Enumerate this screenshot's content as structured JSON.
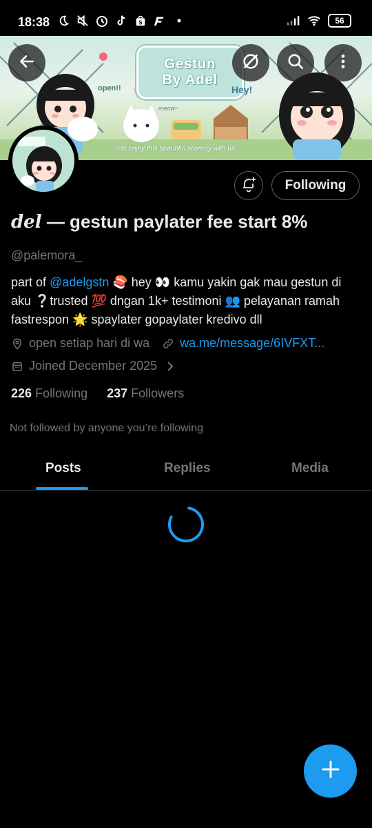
{
  "status_bar": {
    "time": "18:38",
    "battery": "56",
    "icons": [
      "moon-icon",
      "mute-icon",
      "alarm-icon",
      "tiktok-icon",
      "shopee-icon",
      "app-f-icon",
      "dot-icon",
      "signal-icon",
      "wifi-icon",
      "battery-icon"
    ]
  },
  "banner": {
    "sign_line1": "Gestun",
    "sign_line2": "By Adel",
    "note_open": "open!!",
    "note_hey": "Hey!",
    "note_meow": "meow~",
    "note_enjoy": "lets enjoy this beautiful scenery with us!"
  },
  "header": {
    "back_icon": "back-arrow-icon",
    "grok_icon": "slashed-circle-icon",
    "search_icon": "search-icon",
    "more_icon": "more-vertical-icon"
  },
  "profile": {
    "name_styled": "del",
    "name_rest": " — gestun paylater fee start 8%",
    "handle": "@palemora_",
    "bio_prefix": "part of ",
    "bio_mention": "@adelgstn",
    "bio_rest": " 🍣 hey 👀 kamu yakin gak mau gestun di aku ❔trusted 💯 dngan 1k+ testimoni 👥 pelayanan ramah fastrespon 🌟 spaylater gopaylater kredivo dll",
    "location": "open setiap hari di wa",
    "website": "wa.me/message/6IVFXT...",
    "joined": "Joined December 2025",
    "following_count": "226",
    "following_label": "Following",
    "followers_count": "237",
    "followers_label": "Followers",
    "followed_by_note": "Not followed by anyone you’re following"
  },
  "actions": {
    "following_button": "Following",
    "notify_icon": "bell-plus-icon"
  },
  "tabs": [
    {
      "label": "Posts",
      "active": true
    },
    {
      "label": "Replies",
      "active": false
    },
    {
      "label": "Media",
      "active": false
    }
  ],
  "colors": {
    "accent": "#1d9bf0",
    "background": "#000000",
    "text_primary": "#e7e9ea",
    "text_secondary": "#71767b",
    "border": "#2f3336"
  },
  "fab_icon": "plus-icon"
}
